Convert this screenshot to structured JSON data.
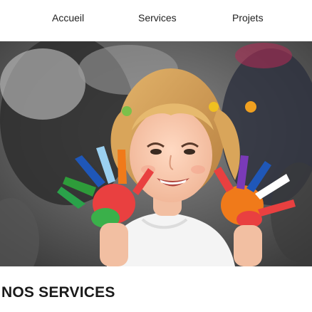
{
  "nav": {
    "items": [
      {
        "label": "Accueil"
      },
      {
        "label": "Services"
      },
      {
        "label": "Projets"
      }
    ]
  },
  "hero": {
    "image": "child-with-painted-hands-photo"
  },
  "section": {
    "title": "NOS SERVICES"
  },
  "colors": {
    "text": "#222222",
    "background": "#ffffff"
  }
}
